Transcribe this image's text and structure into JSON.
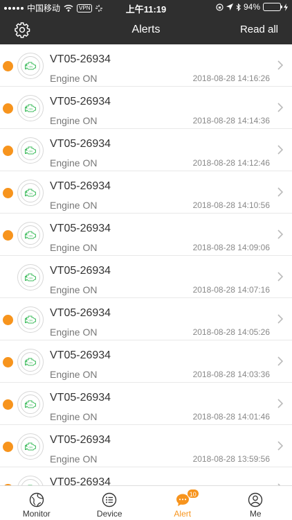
{
  "status_bar": {
    "carrier": "中国移动",
    "vpn": "VPN",
    "time": "上午11:19",
    "battery": "94%",
    "battery_level": 0.94
  },
  "header": {
    "title": "Alerts",
    "read_all_label": "Read all"
  },
  "alerts": [
    {
      "title": "VT05-26934",
      "event": "Engine ON",
      "time": "2018-08-28 14:16:26",
      "unread": true
    },
    {
      "title": "VT05-26934",
      "event": "Engine ON",
      "time": "2018-08-28 14:14:36",
      "unread": true
    },
    {
      "title": "VT05-26934",
      "event": "Engine ON",
      "time": "2018-08-28 14:12:46",
      "unread": true
    },
    {
      "title": "VT05-26934",
      "event": "Engine ON",
      "time": "2018-08-28 14:10:56",
      "unread": true
    },
    {
      "title": "VT05-26934",
      "event": "Engine ON",
      "time": "2018-08-28 14:09:06",
      "unread": true
    },
    {
      "title": "VT05-26934",
      "event": "Engine ON",
      "time": "2018-08-28 14:07:16",
      "unread": false
    },
    {
      "title": "VT05-26934",
      "event": "Engine ON",
      "time": "2018-08-28 14:05:26",
      "unread": true
    },
    {
      "title": "VT05-26934",
      "event": "Engine ON",
      "time": "2018-08-28 14:03:36",
      "unread": true
    },
    {
      "title": "VT05-26934",
      "event": "Engine ON",
      "time": "2018-08-28 14:01:46",
      "unread": true
    },
    {
      "title": "VT05-26934",
      "event": "Engine ON",
      "time": "2018-08-28 13:59:56",
      "unread": true
    },
    {
      "title": "VT05-26934",
      "event": "",
      "time": "",
      "unread": true
    }
  ],
  "tabs": [
    {
      "label": "Monitor",
      "icon": "globe-icon",
      "active": false
    },
    {
      "label": "Device",
      "icon": "list-icon",
      "active": false
    },
    {
      "label": "Alert",
      "icon": "chat-bubble-icon",
      "active": true,
      "badge": "10"
    },
    {
      "label": "Me",
      "icon": "user-icon",
      "active": false
    }
  ],
  "colors": {
    "header_bg": "#2f2f2f",
    "accent": "#f7941d",
    "engine_icon": "#3dbb5c"
  }
}
